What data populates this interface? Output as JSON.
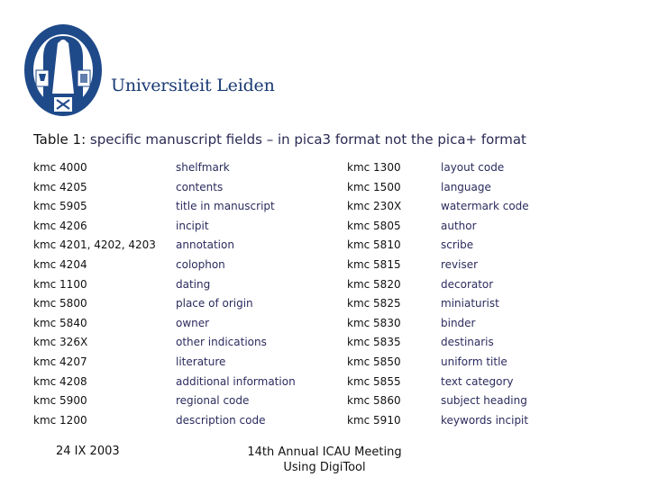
{
  "header": {
    "logo_icon": "university-seal-icon",
    "brand": "Universiteit Leiden",
    "brand_color": "#1a3a73"
  },
  "title": {
    "lead": "Table 1:",
    "rest": " specific manuscript fields – in pica3 format not the pica+ format"
  },
  "rows": [
    {
      "code1": "kmc 4000",
      "field1": "shelfmark",
      "code2": "kmc 1300",
      "field2": "layout code"
    },
    {
      "code1": "kmc 4205",
      "field1": "contents",
      "code2": "kmc 1500",
      "field2": "language"
    },
    {
      "code1": "kmc 5905",
      "field1": "title in manuscript",
      "code2": "kmc 230X",
      "field2": "watermark code"
    },
    {
      "code1": "kmc 4206",
      "field1": "incipit",
      "code2": "kmc 5805",
      "field2": "author"
    },
    {
      "code1": "kmc 4201, 4202, 4203",
      "field1": "annotation",
      "code2": "kmc 5810",
      "field2": "scribe"
    },
    {
      "code1": "kmc 4204",
      "field1": "colophon",
      "code2": "kmc 5815",
      "field2": "reviser"
    },
    {
      "code1": "kmc 1100",
      "field1": "dating",
      "code2": "kmc 5820",
      "field2": "decorator"
    },
    {
      "code1": "kmc 5800",
      "field1": "place of origin",
      "code2": "kmc 5825",
      "field2": "miniaturist"
    },
    {
      "code1": "kmc 5840",
      "field1": "owner",
      "code2": "kmc 5830",
      "field2": "binder"
    },
    {
      "code1": "kmc 326X",
      "field1": "other indications",
      "code2": "kmc 5835",
      "field2": "destinaris"
    },
    {
      "code1": "kmc 4207",
      "field1": "literature",
      "code2": "kmc 5850",
      "field2": "uniform title"
    },
    {
      "code1": "kmc 4208",
      "field1": "additional information",
      "code2": "kmc 5855",
      "field2": "text category"
    },
    {
      "code1": "kmc 5900",
      "field1": "regional code",
      "code2": "kmc 5860",
      "field2": "subject heading"
    },
    {
      "code1": "kmc 1200",
      "field1": "description code",
      "code2": "kmc 5910",
      "field2": "keywords incipit"
    }
  ],
  "footer": {
    "date": "24 IX 2003",
    "meeting_line1": "14th Annual ICAU Meeting",
    "meeting_line2": "Using DigiTool"
  }
}
